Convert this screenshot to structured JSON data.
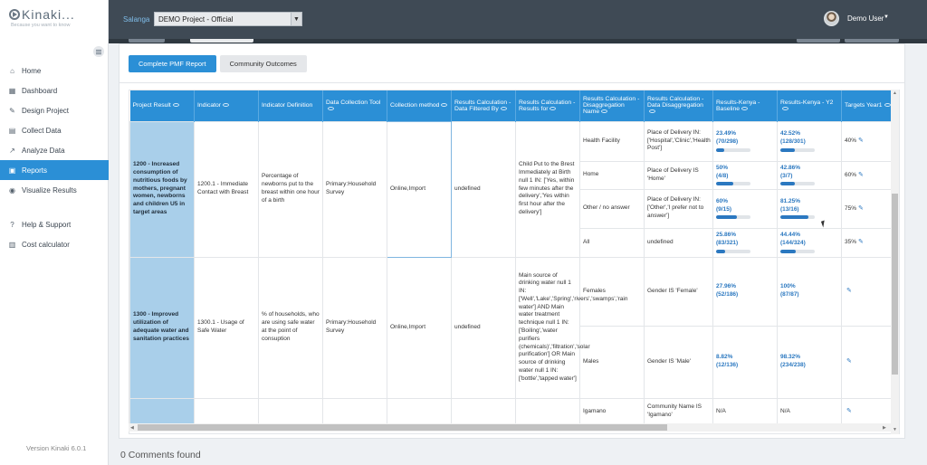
{
  "brand": {
    "name": "Kinaki...",
    "tagline": "Because you want to know"
  },
  "sidebar": {
    "items": [
      {
        "label": "Home",
        "icon": "home-icon"
      },
      {
        "label": "Dashboard",
        "icon": "grid-icon"
      },
      {
        "label": "Design Project",
        "icon": "pencil-icon"
      },
      {
        "label": "Collect Data",
        "icon": "document-icon"
      },
      {
        "label": "Analyze Data",
        "icon": "chart-icon"
      },
      {
        "label": "Reports",
        "icon": "report-icon",
        "active": true
      },
      {
        "label": "Visualize Results",
        "icon": "palette-icon"
      },
      {
        "label": "Help & Support",
        "icon": "help-icon"
      },
      {
        "label": "Cost calculator",
        "icon": "calculator-icon"
      }
    ],
    "version": "Version Kinaki 6.0.1"
  },
  "header": {
    "project_label": "Salanga",
    "project_value": "DEMO Project - Official",
    "user_name": "Demo User"
  },
  "tabs": [
    {
      "label": "Complete PMF Report",
      "active": true
    },
    {
      "label": "Community Outcomes",
      "active": false
    }
  ],
  "table": {
    "headers": [
      "Project Result",
      "Indicator",
      "Indicator Definition",
      "Data Collection Tool",
      "Collection method",
      "Results Calculation - Data Filtered By",
      "Results Calculation - Results for",
      "Results Calculation - Disaggregation Name",
      "Results Calculation - Data Disaggregation",
      "Results-Kenya - Baseline",
      "Results-Kenya - Y2",
      "Targets Year1"
    ],
    "groups": [
      {
        "result": "1200 - Increased consumption of nutritious foods by mothers, pregnant women, newborns and children U5 in target areas",
        "indicator": "1200.1 - Immediate Contact with Breast",
        "definition": "Percentage of newborns put to the breast within one hour of a birth",
        "tool": "Primary:Household Survey",
        "method": "Online,Import",
        "filtered_by": "undefined",
        "results_for": "Child Put to the Brest Immediately at Birth null 1 IN: ['Yes, within few minutes after the delivery','Yes within first hour after the delivery']",
        "rows": [
          {
            "disagg_name": "Health Facility",
            "disagg_data": "Place of Delivery IN: ['Hospital','Clinic','Health Post']",
            "baseline_pct": "23.49%",
            "baseline_frac": "(70/298)",
            "baseline_val": 23.49,
            "y2_pct": "42.52%",
            "y2_frac": "(128/301)",
            "y2_val": 42.52,
            "target": "40%"
          },
          {
            "disagg_name": "Home",
            "disagg_data": "Place of Delivery IS 'Home'",
            "baseline_pct": "50%",
            "baseline_frac": "(4/8)",
            "baseline_val": 50,
            "y2_pct": "42.86%",
            "y2_frac": "(3/7)",
            "y2_val": 42.86,
            "target": "60%"
          },
          {
            "disagg_name": "Other / no answer",
            "disagg_data": "Place of Delivery IN: ['Other','I prefer not to answer']",
            "baseline_pct": "60%",
            "baseline_frac": "(9/15)",
            "baseline_val": 60,
            "y2_pct": "81.25%",
            "y2_frac": "(13/16)",
            "y2_val": 81.25,
            "target": "75%"
          },
          {
            "disagg_name": "All",
            "disagg_data": "undefined",
            "baseline_pct": "25.86%",
            "baseline_frac": "(83/321)",
            "baseline_val": 25.86,
            "y2_pct": "44.44%",
            "y2_frac": "(144/324)",
            "y2_val": 44.44,
            "target": "35%"
          }
        ]
      },
      {
        "result": "1300 - Improved utilization of adequate water and sanitation practices",
        "indicator": "1300.1 - Usage of Safe Water",
        "definition": "% of households, who are using safe water at the point of consuption",
        "tool": "Primary:Household Survey",
        "method": "Online,Import",
        "filtered_by": "undefined",
        "results_for": "Main source of drinking water null 1 IN: ['Well','Lake','Spring','rivers','swamps','rain water'] AND Main water treatment technique null 1 IN: ['Boiling','water purifiers (chemicals)','filtration','solar purification'] OR Main source of drinking water null 1 IN: ['bottle','tapped water']",
        "rows": [
          {
            "disagg_name": "Females",
            "disagg_data": "Gender IS 'Female'",
            "baseline_pct": "27.96%",
            "baseline_frac": "(52/186)",
            "baseline_val": 27.96,
            "y2_pct": "100%",
            "y2_frac": "(87/87)",
            "y2_val": 100,
            "target": ""
          },
          {
            "disagg_name": "Males",
            "disagg_data": "Gender IS 'Male'",
            "baseline_pct": "8.82%",
            "baseline_frac": "(12/136)",
            "baseline_val": 8.82,
            "y2_pct": "98.32%",
            "y2_frac": "(234/238)",
            "y2_val": 98.32,
            "target": ""
          }
        ]
      }
    ],
    "partial_row": {
      "disagg_name": "Igamano",
      "disagg_data": "Community Name IS 'Igamano'",
      "baseline": "N/A",
      "y2": "N/A"
    }
  },
  "comments": "0 Comments found"
}
